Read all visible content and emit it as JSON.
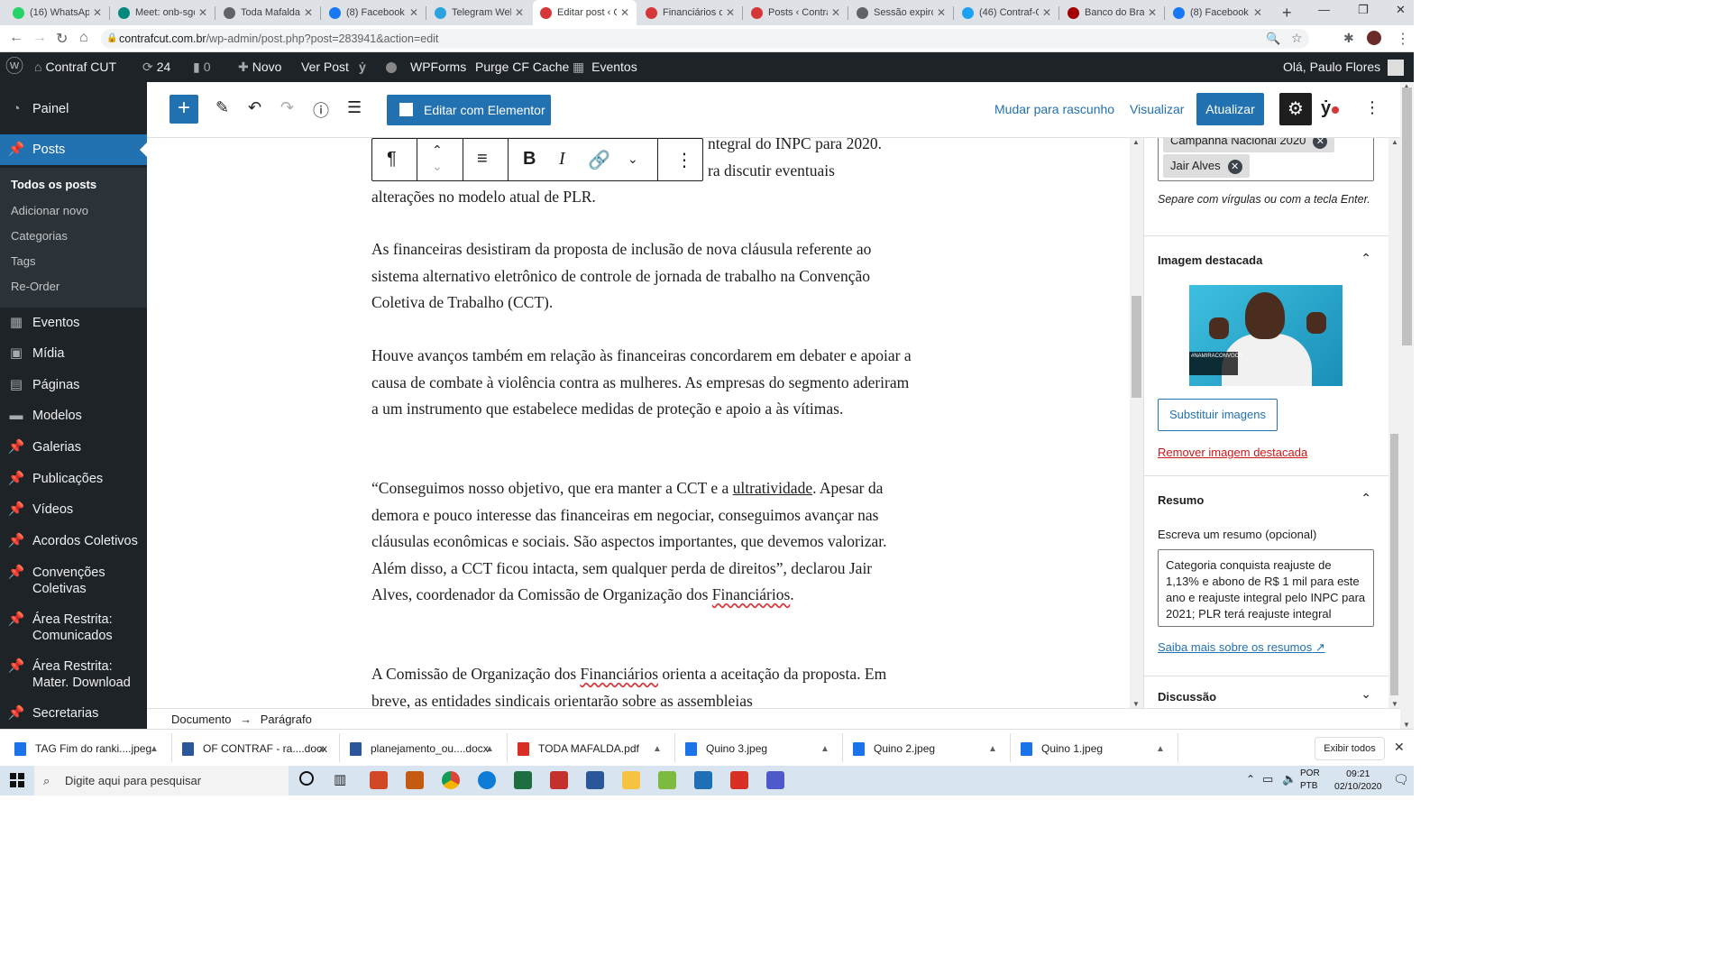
{
  "browser": {
    "tabs": [
      {
        "label": "(16) WhatsApp",
        "color": "#25d366"
      },
      {
        "label": "Meet: onb-sgc",
        "color": "#00897b"
      },
      {
        "label": "Toda Mafalda",
        "color": "#5f6368"
      },
      {
        "label": "(8) Facebook",
        "color": "#1877f2"
      },
      {
        "label": "Telegram Web",
        "color": "#2aa3df"
      },
      {
        "label": "Editar post ‹ C",
        "color": "#d63638"
      },
      {
        "label": "Financiários de",
        "color": "#d63638"
      },
      {
        "label": "Posts ‹ Contraf",
        "color": "#d63638"
      },
      {
        "label": "Sessão expirou",
        "color": "#5f6368"
      },
      {
        "label": "(46) Contraf-C",
        "color": "#1da1f2"
      },
      {
        "label": "Banco do Bras",
        "color": "#a40000"
      },
      {
        "label": "(8) Facebook",
        "color": "#1877f2"
      }
    ],
    "new_tab": "+",
    "url_domain": "contrafcut.com.br",
    "url_path": "/wp-admin/post.php?post=283941&action=edit"
  },
  "adminbar": {
    "site_name": "Contraf CUT",
    "updates_count": "24",
    "comments_count": "0",
    "new_label": "Novo",
    "view_post": "Ver Post",
    "wpforms": "WPForms",
    "purge": "Purge CF Cache",
    "events": "Eventos",
    "greeting": "Olá, Paulo Flores"
  },
  "sidebar": {
    "dashboard": "Painel",
    "posts": "Posts",
    "sub": [
      "Todos os posts",
      "Adicionar novo",
      "Categorias",
      "Tags",
      "Re-Order"
    ],
    "items": [
      "Eventos",
      "Mídia",
      "Páginas",
      "Modelos",
      "Galerias",
      "Publicações",
      "Vídeos",
      "Acordos Coletivos",
      "Convenções Coletivas",
      "Área Restrita: Comunicados",
      "Área Restrita: Mater. Download",
      "Secretarias"
    ]
  },
  "editor": {
    "elementor": "Editar com Elementor",
    "draft": "Mudar para rascunho",
    "preview": "Visualizar",
    "update": "Atualizar"
  },
  "content": {
    "p0_line1": "ntegral do INPC para 2020.",
    "p0_line2": "ra discutir eventuais",
    "p0_line3": "alterações no modelo atual de PLR.",
    "p1": "As financeiras desistiram da proposta de inclusão de nova cláusula referente ao sistema alternativo eletrônico de controle de jornada de trabalho na Convenção Coletiva de Trabalho (CCT).",
    "p2": "Houve avanços também em relação às financeiras concordarem em debater e apoiar a causa de combate à violência contra as mulheres. As empresas do segmento aderiram a um instrumento que estabelece medidas de proteção e apoio a às vítimas.",
    "p3_a": "“Conseguimos nosso objetivo, que era manter a CCT e a ",
    "p3_b": "ultratividade",
    "p3_c": ". Apesar da demora e pouco interesse das financeiras em negociar, conseguimos avançar nas cláusulas econômicas e sociais. São aspectos importantes, que devemos valorizar. Além disso, a CCT ficou intacta, sem qualquer perda de direitos”, declarou Jair Alves, coordenador da Comissão de Organização dos ",
    "p3_d": "Financiários",
    "p3_e": ".",
    "p4_a": "A Comissão de Organização dos ",
    "p4_b": "Financiários",
    "p4_c": " orienta a aceitação da proposta. Em breve, as entidades sindicais orientarão sobre as assembleias"
  },
  "breadcrumb": {
    "doc": "Documento",
    "arrow": "→",
    "block": "Parágrafo"
  },
  "panel": {
    "tag1": "Campanha Nacional 2020",
    "tag2": "Jair Alves",
    "tags_help": "Separe com vírgulas ou com a tecla Enter.",
    "featured_title": "Imagem destacada",
    "featured_banner": "#NAMIRACONVOCA",
    "replace": "Substituir imagens",
    "remove": "Remover imagem destacada",
    "excerpt_title": "Resumo",
    "excerpt_label": "Escreva um resumo (opcional)",
    "excerpt_text": "Categoria conquista reajuste de 1,13% e abono de R$ 1 mil para este ano e reajuste integral pelo INPC para 2021; PLR terá reajuste integral",
    "learn": "Saiba mais sobre os resumos",
    "discussion_title": "Discussão"
  },
  "downloads": [
    {
      "name": "TAG Fim do ranki....jpeg",
      "color": "#1a73e8"
    },
    {
      "name": "OF CONTRAF - ra....docx",
      "color": "#2b579a"
    },
    {
      "name": "planejamento_ou....docx",
      "color": "#2b579a"
    },
    {
      "name": "TODA MAFALDA.pdf",
      "color": "#d93025"
    },
    {
      "name": "Quino 3.jpeg",
      "color": "#1a73e8"
    },
    {
      "name": "Quino 2.jpeg",
      "color": "#1a73e8"
    },
    {
      "name": "Quino 1.jpeg",
      "color": "#1a73e8"
    }
  ],
  "show_all": "Exibir todos",
  "taskbar": {
    "search": "Digite aqui para pesquisar",
    "lang1": "POR",
    "lang2": "PTB",
    "time": "09:21",
    "date": "02/10/2020"
  },
  "colors": {
    "wp_blue": "#2271b1",
    "admin_dark": "#1d2327"
  }
}
